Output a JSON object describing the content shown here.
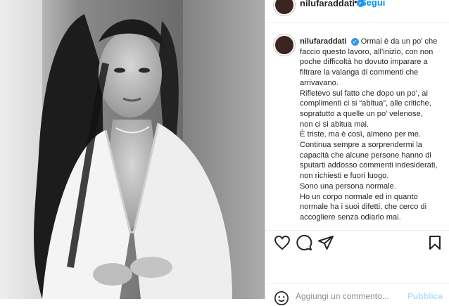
{
  "header": {
    "username": "nilufaraddati",
    "separator": "•",
    "follow_label": "Segui"
  },
  "caption": {
    "username": "nilufaraddati",
    "lines": [
      "Ormai è da un po’ che faccio questo lavoro, all’inizio, con non poche difficoltà ho dovuto imparare a filtrare la valanga di commenti che arrivavano.",
      "Rifletevo sul fatto che dopo un po’, ai complimenti ci si “abitua”, alle critiche, sopratutto a quelle un po’ velenose, non ci si abitua mai.",
      "È triste, ma è così, almeno per me.",
      "Continua sempre a sorprendermi la capacità che alcune persone hanno di sputarti addosso commenti indesiderati, non richiesti e fuori luogo.",
      "Sono una persona normale.",
      "Ho un corpo normale ed in quanto normale ha i suoi difetti, che cerco di accogliere senza odiarlo mai."
    ]
  },
  "actions": {
    "icons": [
      "heart-icon",
      "comment-icon",
      "share-icon",
      "bookmark-icon"
    ]
  },
  "comment_box": {
    "placeholder": "Aggiungi un commento...",
    "publish_label": "Pubblica"
  },
  "colors": {
    "link_blue": "#0095f6",
    "verified_blue": "#3897f0",
    "publish_disabled": "#b2dffc",
    "text": "#262626"
  }
}
